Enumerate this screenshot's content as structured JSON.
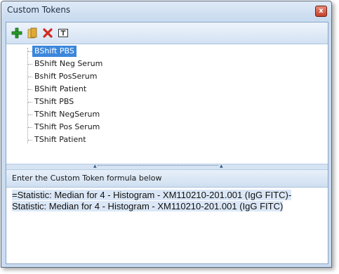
{
  "window": {
    "title": "Custom Tokens",
    "close_label": "x"
  },
  "toolbar": {
    "buttons": [
      {
        "name": "add",
        "icon": "add-icon",
        "color": "#2a9a2a"
      },
      {
        "name": "open",
        "icon": "folder-icon",
        "color": "#d9a630"
      },
      {
        "name": "delete",
        "icon": "delete-icon",
        "color": "#d12b1f"
      },
      {
        "name": "text",
        "icon": "text-edit-icon",
        "color": "#303030"
      }
    ]
  },
  "tree": {
    "items": [
      {
        "label": "BShift PBS",
        "selected": true
      },
      {
        "label": "BShift Neg Serum",
        "selected": false
      },
      {
        "label": "Bshift PosSerum",
        "selected": false
      },
      {
        "label": "BShift Patient",
        "selected": false
      },
      {
        "label": "TShift PBS",
        "selected": false
      },
      {
        "label": "TShift NegSerum",
        "selected": false
      },
      {
        "label": "TShift Pos Serum",
        "selected": false
      },
      {
        "label": "TShift Patient",
        "selected": false
      }
    ]
  },
  "formula": {
    "header": "Enter the Custom Token formula below",
    "text": "=Statistic: Median for 4 - Histogram - XM110210-201.001 (IgG FITC)-Statistic: Median for 4 - Histogram - XM110210-201.001 (IgG FITC)"
  },
  "colors": {
    "selection": "#3b87dc",
    "accent": "#c9dcf1"
  }
}
